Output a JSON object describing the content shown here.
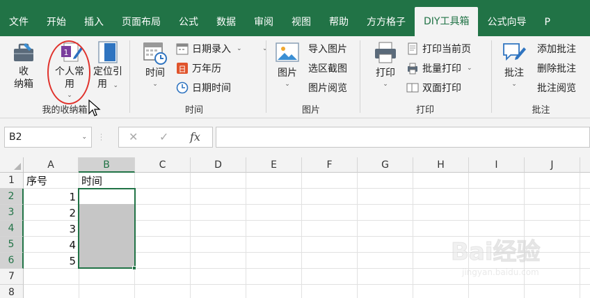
{
  "tabs": [
    "文件",
    "开始",
    "插入",
    "页面布局",
    "公式",
    "数据",
    "审阅",
    "视图",
    "帮助",
    "方方格子",
    "DIY工具箱",
    "公式向导",
    "P"
  ],
  "active_tab": "DIY工具箱",
  "ribbon": {
    "mybox": {
      "label": "我的收纳箱",
      "shounaxiang": {
        "line1": "收",
        "line2": "纳箱"
      },
      "personal": {
        "line1": "个人常",
        "line2": "用"
      },
      "locate": {
        "line1": "定位引",
        "line2": "用"
      }
    },
    "time": {
      "label": "时间",
      "big": "时间",
      "date_entry": "日期录入",
      "calendar": "万年历",
      "datetime": "日期时间"
    },
    "picture": {
      "label": "图片",
      "big": "图片",
      "import": "导入图片",
      "screenshot": "选区截图",
      "browse": "图片阅览"
    },
    "print": {
      "label": "打印",
      "big": "打印",
      "current_page": "打印当前页",
      "batch": "批量打印",
      "duplex": "双面打印"
    },
    "comment": {
      "label": "批注",
      "big": "批注",
      "add": "添加批注",
      "delete": "删除批注",
      "browse": "批注阅览"
    }
  },
  "formula_bar": {
    "name_box": "B2",
    "cancel_icon": "✕",
    "enter_icon": "✓",
    "fx_label": "fx",
    "value": ""
  },
  "columns": [
    "A",
    "B",
    "C",
    "D",
    "E",
    "F",
    "G",
    "H",
    "I",
    "J"
  ],
  "rows": [
    "1",
    "2",
    "3",
    "4",
    "5",
    "6",
    "7",
    "8"
  ],
  "cells": {
    "A1": "序号",
    "B1": "时间",
    "A2": "1",
    "A3": "2",
    "A4": "3",
    "A5": "4",
    "A6": "5"
  },
  "selected_column": "B",
  "selected_rows": [
    "2",
    "3",
    "4",
    "5",
    "6"
  ],
  "colors": {
    "accent": "#217346",
    "highlight_circle": "#e0322c"
  },
  "watermark": {
    "main": "Bai经验",
    "sub": "jingyan.baidu.com"
  }
}
